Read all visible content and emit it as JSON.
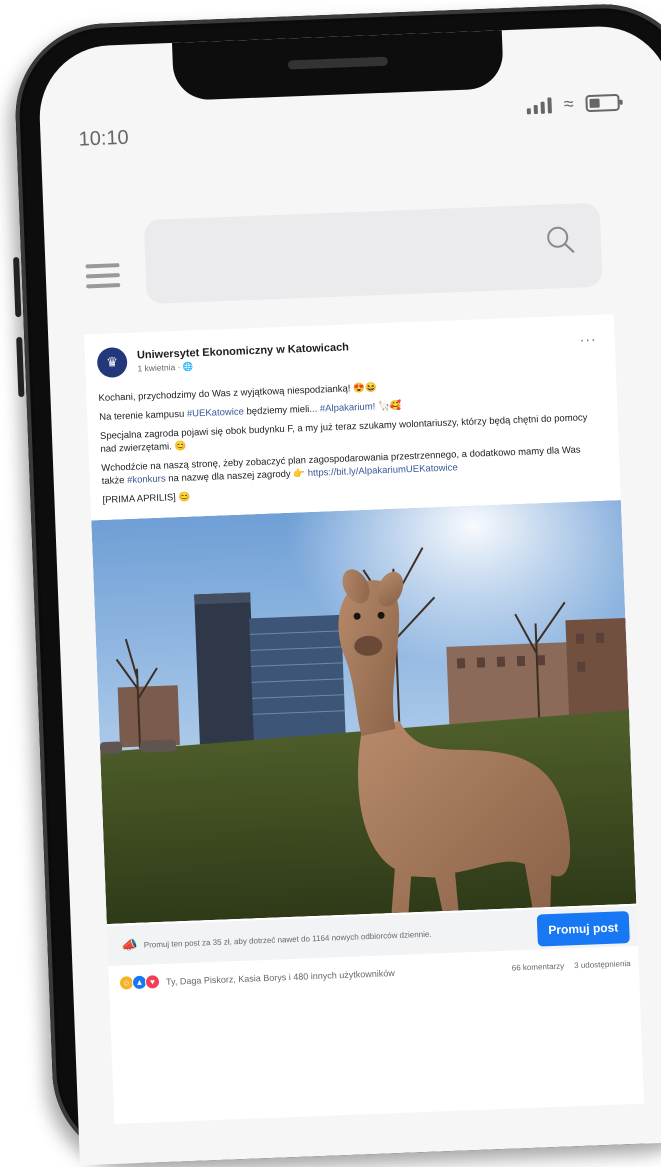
{
  "status_bar": {
    "time": "10:10"
  },
  "post": {
    "page_name": "Uniwersytet Ekonomiczny w Katowicach",
    "date": "1 kwietnia · ",
    "more_label": "···",
    "paragraphs": [
      {
        "parts": [
          {
            "text": "Kochani, przychodzimy do Was z wyjątkową niespodzianką! 😍😆",
            "tag": false
          }
        ]
      },
      {
        "parts": [
          {
            "text": "Na terenie kampusu ",
            "tag": false
          },
          {
            "text": "#UEKatowice",
            "tag": true
          },
          {
            "text": " będziemy mieli... ",
            "tag": false
          },
          {
            "text": "#Alpakarium!",
            "tag": true
          },
          {
            "text": " 🦙🥰",
            "tag": false
          }
        ]
      },
      {
        "parts": [
          {
            "text": "Specjalna zagroda pojawi się obok budynku F, a my już teraz szukamy wolontariuszy, którzy będą chętni do pomocy nad zwierzętami. 😊",
            "tag": false
          }
        ]
      },
      {
        "parts": [
          {
            "text": "Wchodźcie na naszą stronę, żeby zobaczyć plan zagospodarowania przestrzennego, a  dodatkowo mamy dla Was także ",
            "tag": false
          },
          {
            "text": "#konkurs",
            "tag": true
          },
          {
            "text": " na nazwę dla naszej zagrody 👉  ",
            "tag": false
          },
          {
            "text": "https://bit.ly/AlpakariumUEKatowice",
            "tag": true
          }
        ]
      },
      {
        "parts": [
          {
            "text": "[PRIMA APRILIS] 😊",
            "tag": false
          }
        ]
      }
    ],
    "promo_text": "Promuj ten post za 35 zł, aby dotrzeć nawet do 1164 nowych odbiorców dziennie.",
    "promo_button": "Promuj post",
    "reaction_names": "Ty, Daga Piskorz, Kasia Borys i 480 innych użytkowników",
    "comments": "66 komentarzy",
    "shares": "3 udostępnienia"
  },
  "icons": {
    "search": "search-icon",
    "menu": "hamburger-icon",
    "promo": "megaphone-icon",
    "more": "more-icon"
  },
  "colors": {
    "accent": "#1877f2",
    "hashtag": "#385898",
    "page_avatar": "#23387a"
  }
}
